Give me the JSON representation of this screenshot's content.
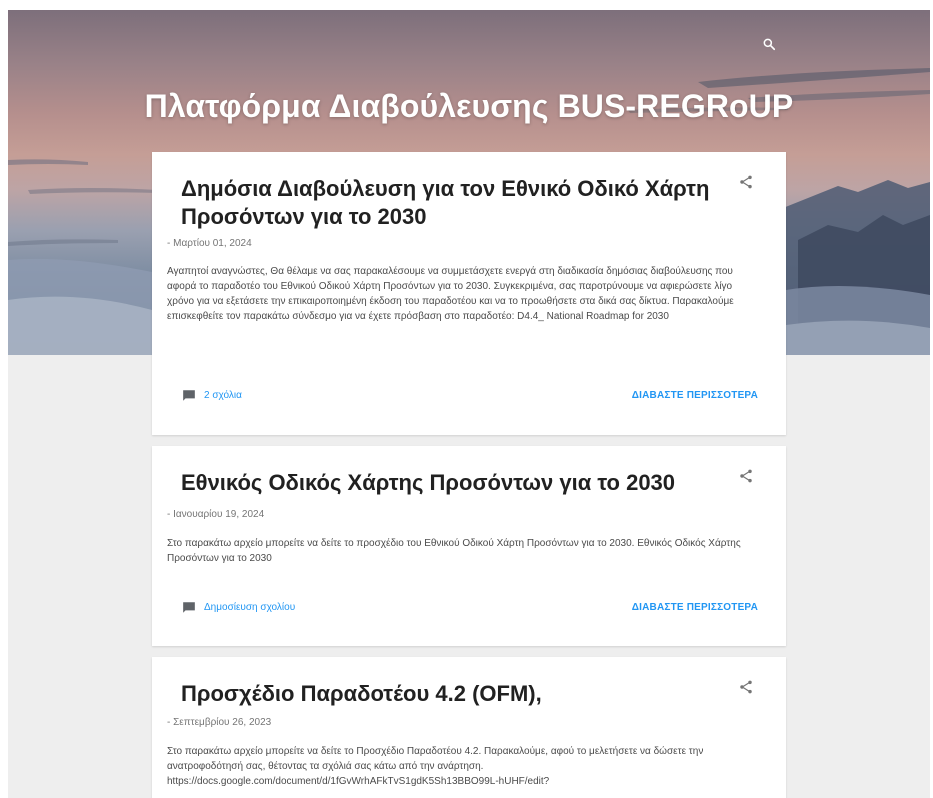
{
  "header": {
    "title": "Πλατφόρμα Διαβούλευσης BUS-REGRoUP",
    "search_icon": "search-icon"
  },
  "posts": [
    {
      "title": "Δημόσια Διαβούλευση για τον Εθνικό Οδικό Χάρτη Προσόντων για το 2030",
      "date": "- Μαρτίου 01, 2024",
      "snippet": "Αγαπητοί αναγνώστες, Θα θέλαμε να σας παρακαλέσουμε να συμμετάσχετε ενεργά στη διαδικασία δημόσιας διαβούλευσης που αφορά το παραδοτέο του Εθνικού Οδικού Χάρτη Προσόντων για το 2030. Συγκεκριμένα, σας παροτρύνουμε να αφιερώσετε λίγο χρόνο για να εξετάσετε την επικαιροποιημένη έκδοση του παραδοτέου και να το προωθήσετε στα δικά σας δίκτυα. Παρακαλούμε επισκεφθείτε τον παρακάτω σύνδεσμο για να έχετε πρόσβαση στο παραδοτέο: D4.4_ National Roadmap for 2030",
      "comments": "2 σχόλια",
      "read_more": "ΔΙΑΒΑΣΤΕ ΠΕΡΙΣΣΟΤΕΡΑ"
    },
    {
      "title": "Εθνικός Οδικός Χάρτης Προσόντων για το 2030",
      "date": "- Ιανουαρίου 19, 2024",
      "snippet": "Στο παρακάτω αρχείο μπορείτε να δείτε το προσχέδιο του Εθνικού Οδικού Χάρτη Προσόντων για το 2030. Εθνικός Οδικός Χάρτης Προσόντων για το 2030",
      "comments": "Δημοσίευση σχολίου",
      "read_more": "ΔΙΑΒΑΣΤΕ ΠΕΡΙΣΣΟΤΕΡΑ"
    },
    {
      "title": "Προσχέδιο Παραδοτέου 4.2 (OFM),",
      "date": "- Σεπτεμβρίου 26, 2023",
      "snippet": " Στο παρακάτω αρχείο μπορείτε να δείτε το Προσχέδιο Παραδοτέου 4.2.  Παρακαλούμε, αφού το μελετήσετε να δώσετε την ανατροφοδότησή σας, θέτοντας τα σχόλιά σας κάτω από την ανάρτηση. https://docs.google.com/document/d/1fGvWrhAFkTvS1gdK5Sh13BBO99L-hUHF/edit?"
    }
  ],
  "icons": {
    "share": "share-icon",
    "comment": "comment-icon"
  },
  "colors": {
    "link": "#2196f3",
    "title": "#212121",
    "background": "#eeeeee"
  }
}
